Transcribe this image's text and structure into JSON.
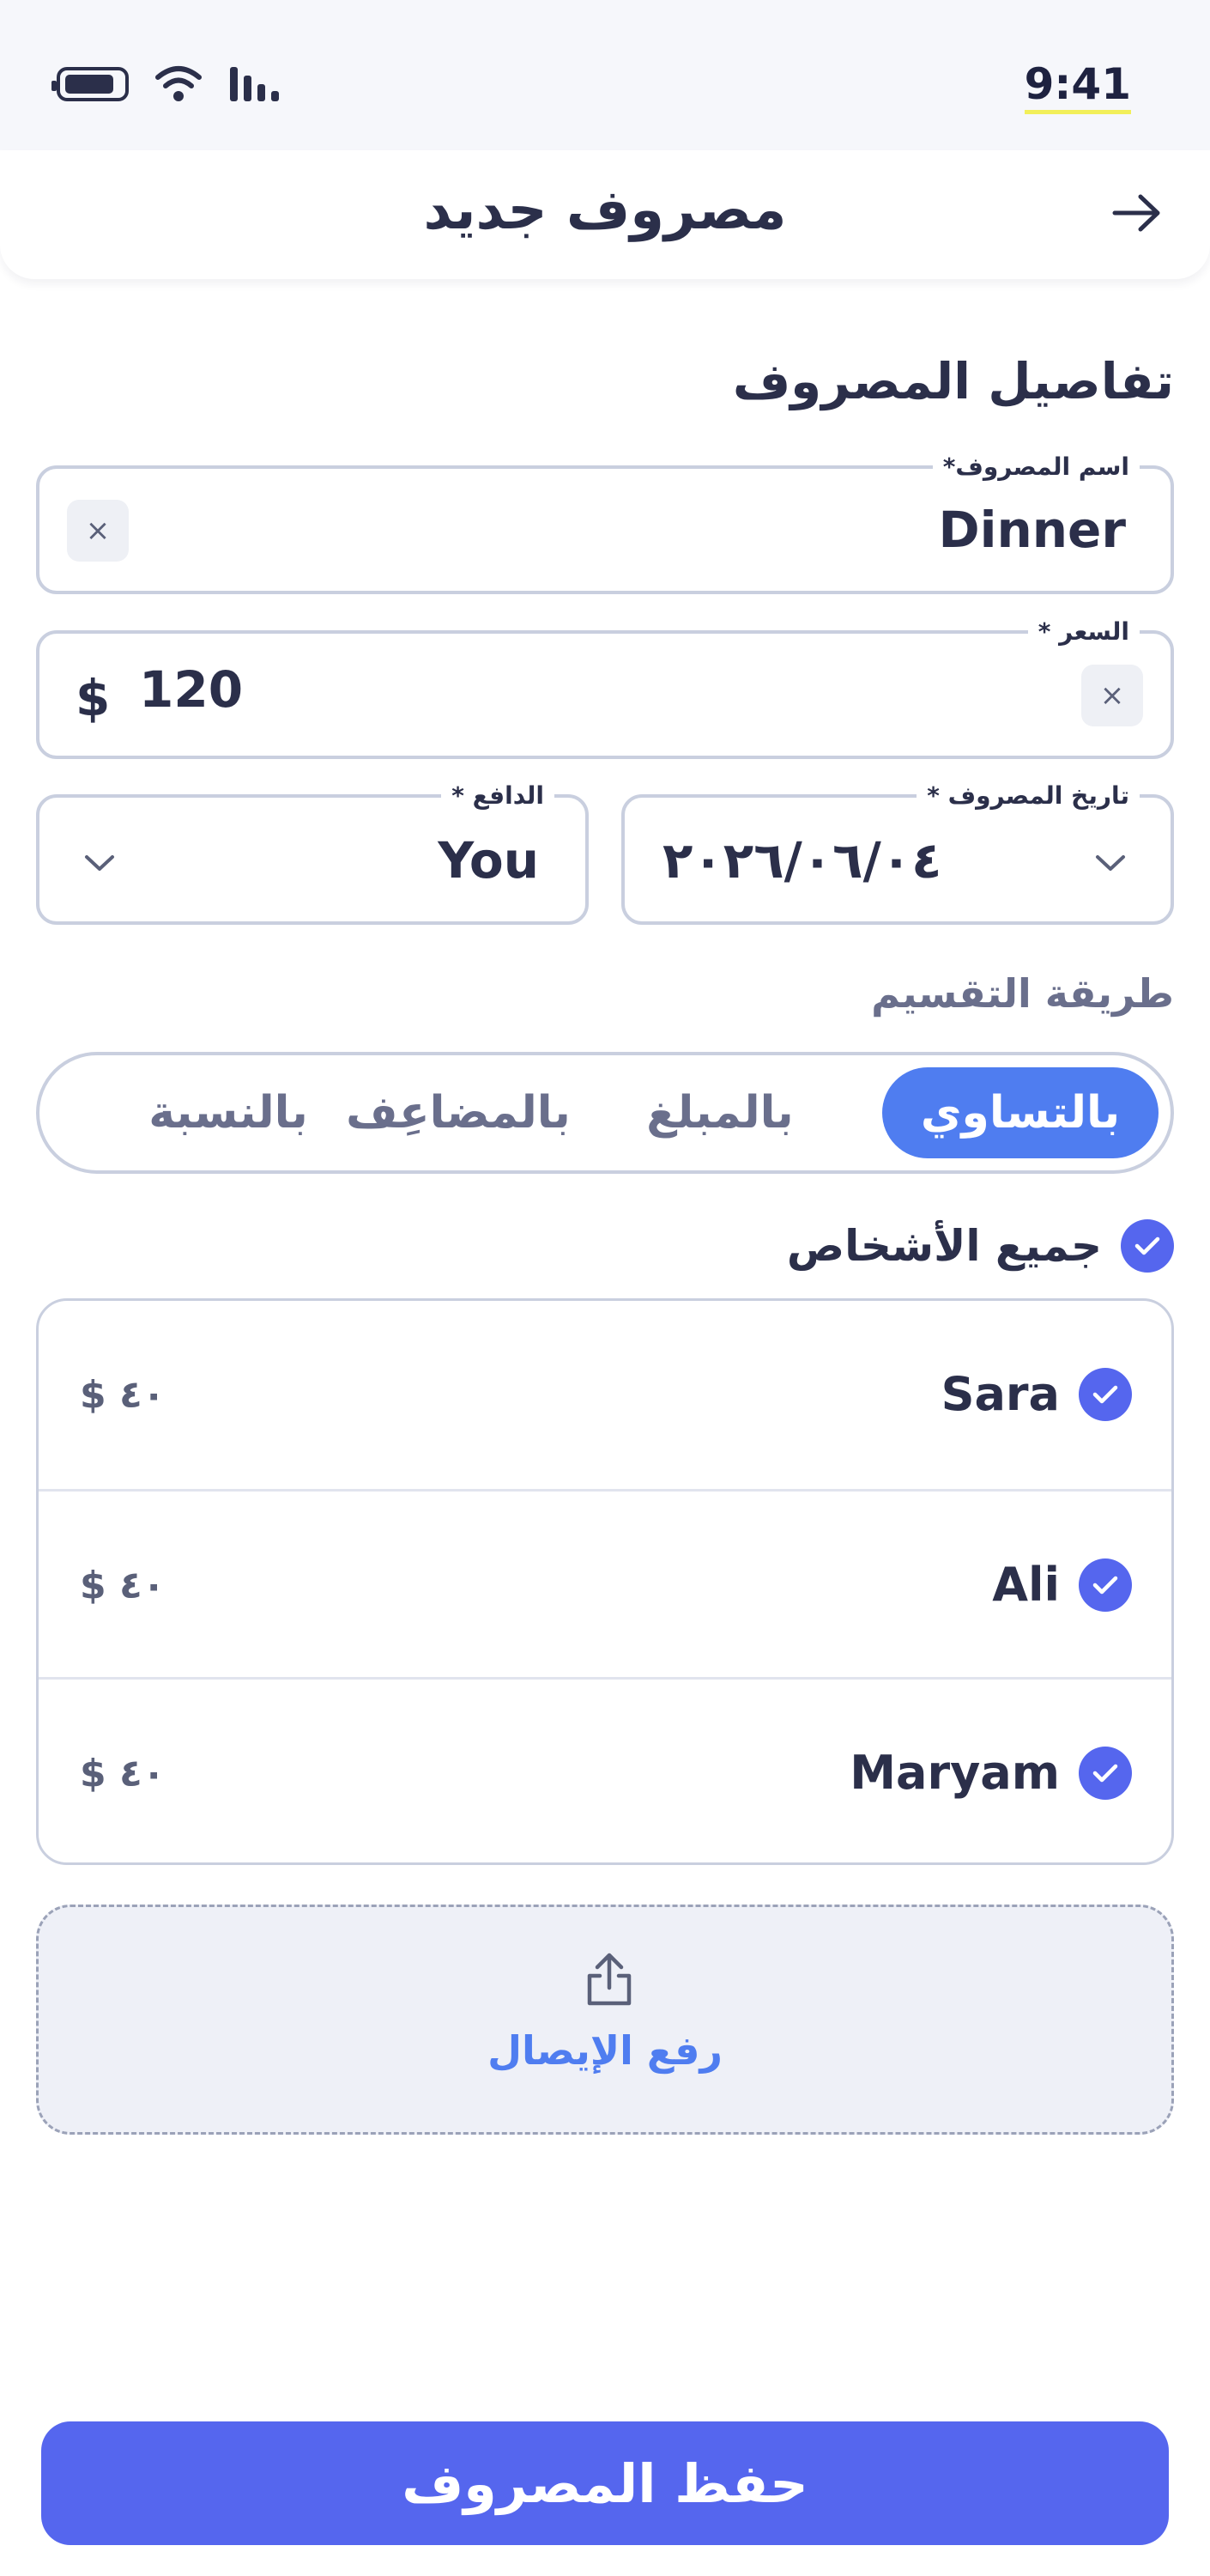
{
  "status_bar": {
    "time": "9:41"
  },
  "header": {
    "title": "مصروف جديد"
  },
  "section": {
    "title": "تفاصيل المصروف"
  },
  "expense_name": {
    "label": "اسم المصروف*",
    "value": "Dinner",
    "clear": "×"
  },
  "price": {
    "label": "السعر *",
    "value": "120",
    "currency": "$",
    "clear": "×"
  },
  "date": {
    "label": "تاريخ المصروف *",
    "value": "٢٠٢٦/٠٦/٠٤"
  },
  "payer": {
    "label": "الدافع *",
    "value": "You"
  },
  "split": {
    "label": "طريقة التقسيم",
    "options": [
      "بالتساوي",
      "بالمبلغ",
      "بالمضاعِف",
      "بالنسبة"
    ],
    "selected": "بالتساوي"
  },
  "participants": {
    "all_label": "جميع الأشخاص",
    "people": [
      {
        "name": "Sara",
        "amount": "$ ٤٠",
        "checked": true
      },
      {
        "name": "Ali",
        "amount": "$ ٤٠",
        "checked": true
      },
      {
        "name": "Maryam",
        "amount": "$ ٤٠",
        "checked": true
      }
    ]
  },
  "upload": {
    "label": "رفع الإيصال"
  },
  "save_button": {
    "label": "حفظ المصروف"
  },
  "colors": {
    "primary": "#5566ee",
    "accent": "#4f7df0",
    "border": "#c9cfdf",
    "text": "#2b2f4a"
  }
}
